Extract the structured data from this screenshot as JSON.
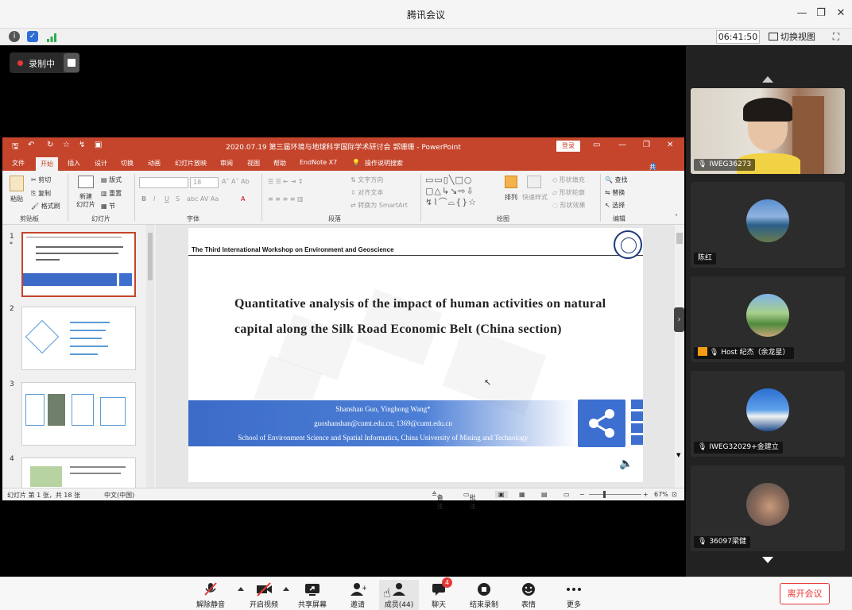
{
  "window": {
    "title": "腾讯会议"
  },
  "infobar": {
    "time": "06:41:50",
    "switch_view": "切换视图"
  },
  "recording": {
    "label": "录制中"
  },
  "ppt": {
    "window_title": "2020.07.19 第三届环境与地球科学国际学术研讨会 郭珊珊 - PowerPoint",
    "login": "登录",
    "share": "共享",
    "tabs": [
      "文件",
      "开始",
      "插入",
      "设计",
      "切换",
      "动画",
      "幻灯片放映",
      "审阅",
      "视图",
      "帮助",
      "EndNote X7",
      "操作说明搜索"
    ],
    "active_tab": 1,
    "ribbon": {
      "paste": "粘贴",
      "cut": "剪切",
      "copy": "复制",
      "format_painter": "格式刷",
      "clipboard": "剪贴板",
      "new_slide": "新建\n幻灯片",
      "layout": "版式",
      "reset": "重置",
      "section": "节",
      "slides": "幻灯片",
      "font_size": "18",
      "font": "字体",
      "text_direction": "文字方向",
      "align_text": "对齐文本",
      "smartart": "转换为 SmartArt",
      "paragraph": "段落",
      "arrange": "排列",
      "quick_styles": "快速样式",
      "shape_fill": "形状填充",
      "shape_outline": "形状轮廓",
      "shape_effects": "形状效果",
      "drawing": "绘图",
      "find": "查找",
      "replace": "替换",
      "select": "选择",
      "editing": "编辑"
    },
    "thumbs": [
      {
        "num": "1"
      },
      {
        "num": "2"
      },
      {
        "num": "3"
      },
      {
        "num": "4"
      }
    ],
    "slide": {
      "workshop": "The Third International Workshop on Environment and Geoscience",
      "title": "Quantitative analysis of the impact of human activities on natural capital along the Silk Road Economic Belt (China section)",
      "authors": "Shanshan Guo, Yinghong Wang*",
      "emails": "guoshanshan@cumt.edu.cn; 1369@cumt.edu.cn",
      "affiliation": "School of Environment Science and Spatial Informatics, China University of Mining and Technology"
    },
    "status": {
      "slide_count": "幻灯片 第 1 张，共 18 张",
      "language": "中文(中国)",
      "notes": "备注",
      "comments": "批注",
      "zoom": "67%"
    }
  },
  "participants": [
    {
      "name": "IWEG36273"
    },
    {
      "name": "陈红"
    },
    {
      "name": "Host 纪杰（余龙星）"
    },
    {
      "name": "IWEG32029+金建立"
    },
    {
      "name": "36097梁健"
    }
  ],
  "toolbar": {
    "unmute": "解除静音",
    "video": "开启视频",
    "share_screen": "共享屏幕",
    "invite": "邀请",
    "members": "成员(44)",
    "chat": "聊天",
    "chat_badge": "4",
    "end_record": "结束录制",
    "emoji": "表情",
    "more": "更多",
    "leave": "离开会议"
  }
}
